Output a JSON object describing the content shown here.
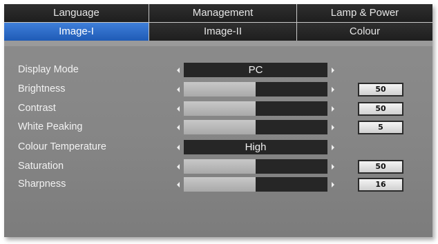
{
  "tabs_row1": [
    {
      "label": "Language"
    },
    {
      "label": "Management"
    },
    {
      "label": "Lamp & Power"
    }
  ],
  "tabs_row2": [
    {
      "label": "Image-I",
      "active": true
    },
    {
      "label": "Image-II"
    },
    {
      "label": "Colour"
    }
  ],
  "items": [
    {
      "label": "Display Mode",
      "kind": "select",
      "value": "PC"
    },
    {
      "label": "Brightness",
      "kind": "slider",
      "value": "50",
      "level": 0.5
    },
    {
      "label": "Contrast",
      "kind": "slider",
      "value": "50",
      "level": 0.5
    },
    {
      "label": "White Peaking",
      "kind": "slider",
      "value": "5",
      "level": 0.5
    },
    {
      "label": "Colour Temperature",
      "kind": "select",
      "value": "High"
    },
    {
      "label": "Saturation",
      "kind": "slider",
      "value": "50",
      "level": 0.5
    },
    {
      "label": "Sharpness",
      "kind": "slider",
      "value": "16",
      "level": 0.5
    }
  ],
  "colors": {
    "active_tab": "#2f6fcc",
    "panel": "#878787",
    "bar_track": "#262626",
    "bar_fill": "#b9b9b9"
  }
}
